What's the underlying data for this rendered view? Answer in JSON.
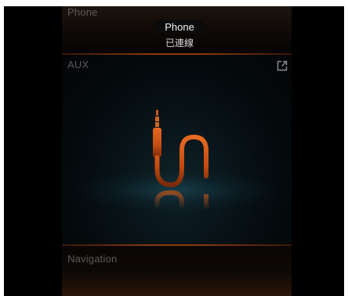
{
  "phone": {
    "title": "Phone",
    "device_name": "Phone",
    "status": "已連線"
  },
  "aux": {
    "title": "AUX",
    "icon": "aux-cable-icon",
    "open_icon": "external-link-icon"
  },
  "navigation": {
    "title": "Navigation"
  },
  "colors": {
    "accent": "#d2611c",
    "divider": "#8a3a10",
    "background": "#000000",
    "glow": "#1c4e5c"
  }
}
